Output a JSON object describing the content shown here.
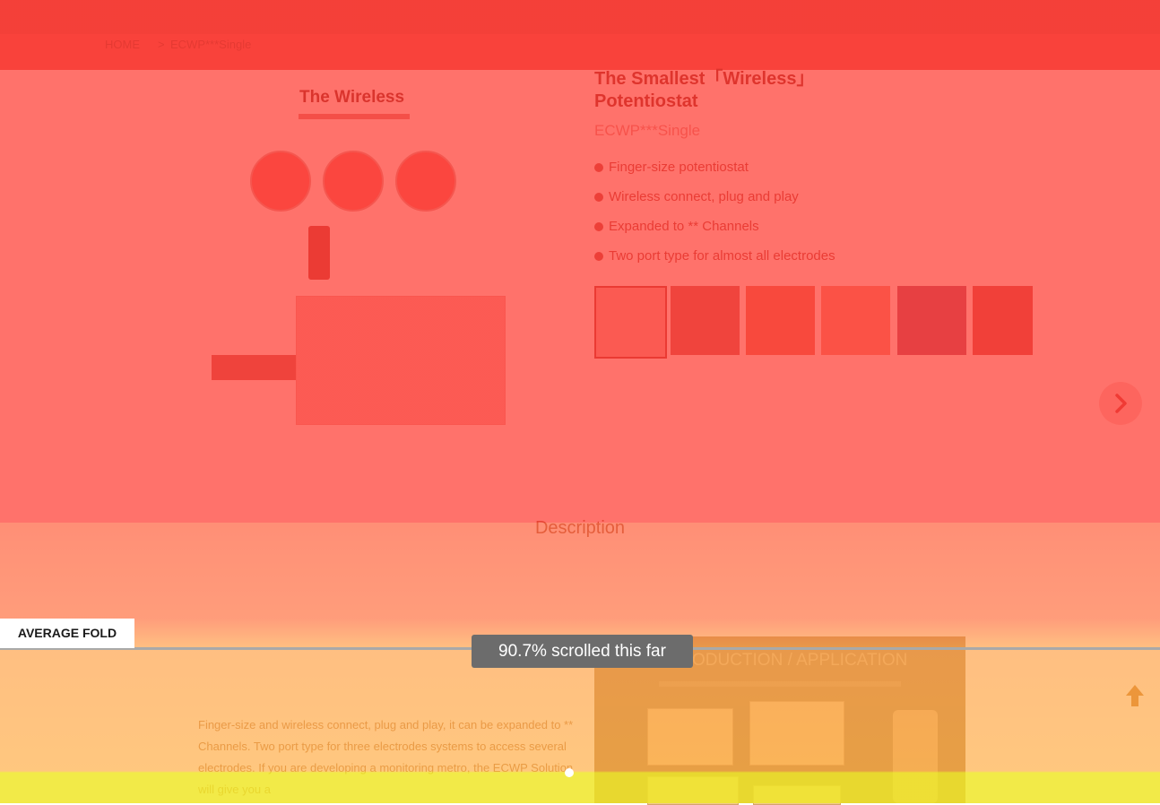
{
  "breadcrumb": {
    "home": "HOME",
    "separator": ">",
    "current": "ECWP***Single"
  },
  "hero": {
    "title": "The Wireless"
  },
  "product": {
    "title": "The Smallest「Wireless」Potentiostat",
    "model": "ECWP***Single",
    "features": [
      "Finger-size potentiostat",
      "Wireless connect, plug and play",
      "Expanded to ** Channels",
      "Two port type for almost all electrodes"
    ],
    "thumbnail_count": 6
  },
  "nav": {
    "next_icon": "chevron-right-icon",
    "top_icon": "arrow-up-icon"
  },
  "description_tab": "Description",
  "intro": {
    "title": "INTRODUCTION / APPLICATION"
  },
  "body_text": "Finger-size and wireless connect, plug and play, it can be expanded to ** Channels. Two port type for three electrodes systems to access several electrodes. If you are developing a monitoring metro, the ECWP Solution will give you a",
  "heatmap": {
    "fold_label": "AVERAGE FOLD",
    "scroll_tooltip": "90.7% scrolled this far",
    "colors": {
      "hot": "#ff3c32",
      "warm": "#ffa046",
      "cool": "#f0e628"
    }
  }
}
